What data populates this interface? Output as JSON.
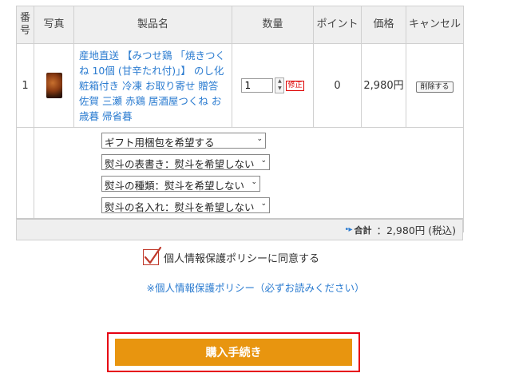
{
  "table": {
    "headers": {
      "no": "番号",
      "photo": "写真",
      "name": "製品名",
      "qty": "数量",
      "point": "ポイント",
      "price": "価格",
      "cancel": "キャンセル"
    },
    "items": [
      {
        "no": "1",
        "photo_icon": "product-thumbnail",
        "name": "産地直送 【みつせ鶏 「焼きつくね 10個 (甘辛たれ付)」】 のし化粧箱付き 冷凍 お取り寄せ 贈答 佐賀 三瀬 赤鶏 居酒屋つくね お歳暮 帰省暮",
        "qty": "1",
        "fix_label": "修正",
        "point": "0",
        "price": "2,980円",
        "delete_label": "削除する"
      }
    ],
    "options": {
      "gift_wrap": "ギフト用梱包を希望する",
      "noshi_surface": "熨斗の表書き：熨斗を希望しない",
      "noshi_type": "熨斗の種類：熨斗を希望しない",
      "noshi_name": "熨斗の名入れ：熨斗を希望しない"
    }
  },
  "total": {
    "label": "合計",
    "value": "：2,980円 (税込)"
  },
  "privacy": {
    "agree_label": "個人情報保護ポリシーに同意する",
    "checked": true,
    "link_text": "※個人情報保護ポリシー（必ずお読みください）"
  },
  "purchase": {
    "button_label": "購入手続き"
  },
  "colors": {
    "link": "#2a7bd0",
    "button": "#e8950f",
    "highlight_border": "#e60012",
    "check": "#c0392b"
  }
}
